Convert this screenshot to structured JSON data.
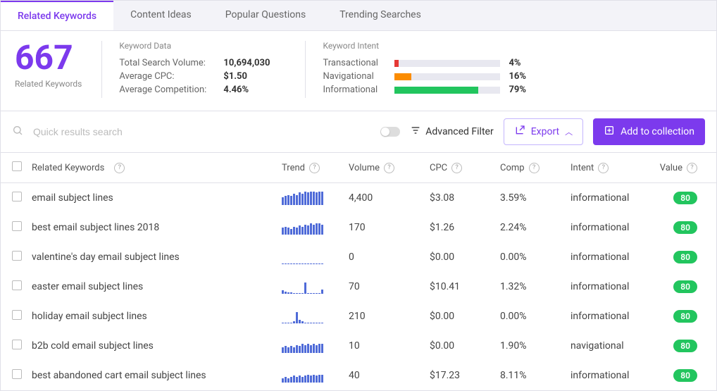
{
  "tabs": [
    "Related Keywords",
    "Content Ideas",
    "Popular Questions",
    "Trending Searches"
  ],
  "active_tab": 0,
  "summary": {
    "count": "667",
    "count_label": "Related Keywords",
    "keyword_data": {
      "title": "Keyword Data",
      "rows": [
        {
          "label": "Total Search Volume:",
          "value": "10,694,030"
        },
        {
          "label": "Average CPC:",
          "value": "$1.50"
        },
        {
          "label": "Average Competition:",
          "value": "4.46%"
        }
      ]
    },
    "keyword_intent": {
      "title": "Keyword Intent",
      "rows": [
        {
          "label": "Transactional",
          "pct": 4,
          "color": "#e53935"
        },
        {
          "label": "Navigational",
          "pct": 16,
          "color": "#fb8c00"
        },
        {
          "label": "Informational",
          "pct": 79,
          "color": "#22c55e"
        }
      ]
    }
  },
  "toolbar": {
    "search_placeholder": "Quick results search",
    "advanced_filter": "Advanced Filter",
    "export": "Export",
    "add": "Add to collection"
  },
  "columns": [
    "Related Keywords",
    "Trend",
    "Volume",
    "CPC",
    "Comp",
    "Intent",
    "Value"
  ],
  "rows": [
    {
      "keyword": "email subject lines",
      "trend": [
        7,
        8,
        9,
        8,
        10,
        9,
        11,
        10,
        12,
        11,
        12,
        12,
        11,
        12,
        12
      ],
      "volume": "4,400",
      "cpc": "$3.08",
      "comp": "3.59%",
      "intent": "informational",
      "value": "80"
    },
    {
      "keyword": "best email subject lines 2018",
      "trend": [
        6,
        7,
        6,
        5,
        7,
        6,
        8,
        7,
        9,
        8,
        10,
        9,
        10,
        10,
        9
      ],
      "volume": "170",
      "cpc": "$1.26",
      "comp": "2.24%",
      "intent": "informational",
      "value": "80"
    },
    {
      "keyword": "valentine's day email subject lines",
      "trend": [
        0,
        0,
        0,
        0,
        0,
        0,
        0,
        0,
        0,
        0,
        0,
        0,
        0,
        0,
        0
      ],
      "volume": "0",
      "cpc": "$0.00",
      "comp": "0.00%",
      "intent": "informational",
      "value": "80"
    },
    {
      "keyword": "easter email subject lines",
      "trend": [
        3,
        2,
        1,
        1,
        0,
        0,
        0,
        0,
        10,
        0,
        0,
        0,
        0,
        0,
        4
      ],
      "volume": "70",
      "cpc": "$10.41",
      "comp": "1.32%",
      "intent": "informational",
      "value": "80"
    },
    {
      "keyword": "holiday email subject lines",
      "trend": [
        0,
        0,
        0,
        0,
        2,
        10,
        3,
        2,
        0,
        0,
        0,
        0,
        0,
        0,
        0
      ],
      "volume": "210",
      "cpc": "$0.00",
      "comp": "0.00%",
      "intent": "informational",
      "value": "80"
    },
    {
      "keyword": "b2b cold email subject lines",
      "trend": [
        5,
        6,
        5,
        6,
        5,
        7,
        6,
        8,
        7,
        8,
        7,
        8,
        7,
        8,
        8
      ],
      "volume": "10",
      "cpc": "$0.00",
      "comp": "1.90%",
      "intent": "navigational",
      "value": "80"
    },
    {
      "keyword": "best abandoned cart email subject lines",
      "trend": [
        4,
        5,
        4,
        5,
        6,
        5,
        6,
        5,
        6,
        7,
        6,
        7,
        6,
        7,
        7
      ],
      "volume": "40",
      "cpc": "$17.23",
      "comp": "8.11%",
      "intent": "informational",
      "value": "80"
    }
  ]
}
